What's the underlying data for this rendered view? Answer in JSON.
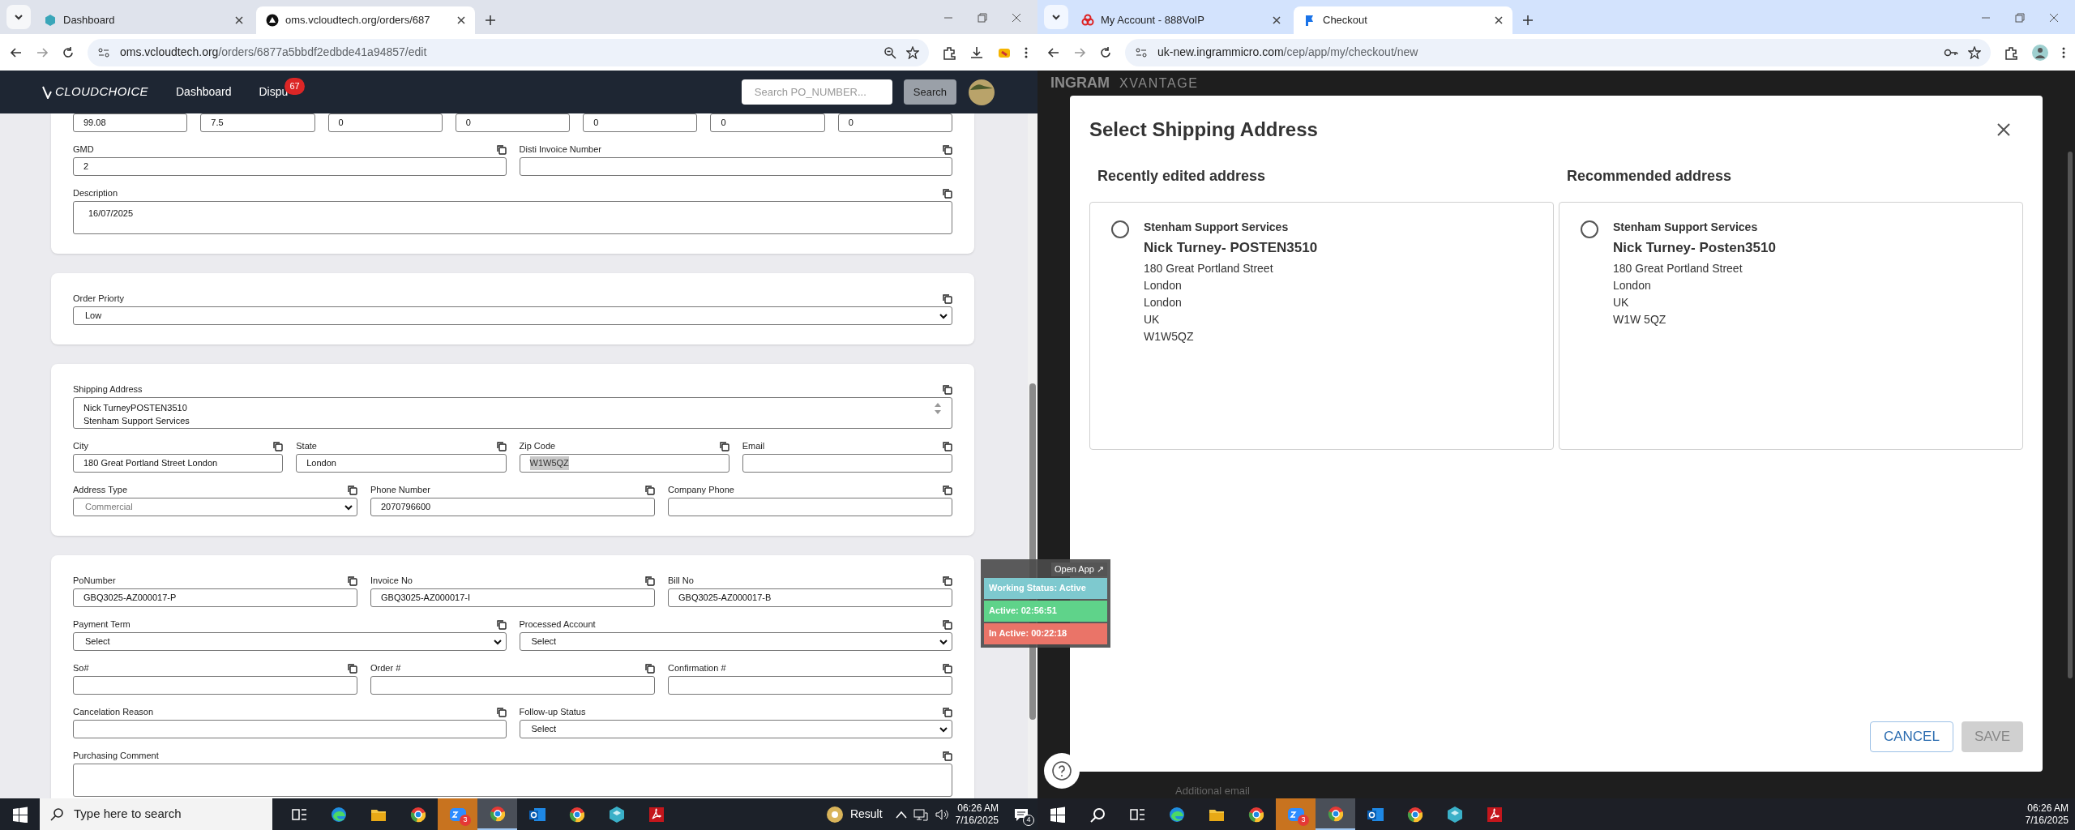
{
  "left_window": {
    "tabs": [
      {
        "title": "Dashboard",
        "selected": false
      },
      {
        "title": "oms.vcloudtech.org/orders/687",
        "selected": true
      }
    ],
    "url": {
      "host": "oms.vcloudtech.org",
      "path": "/orders/6877a5bbdf2edbde41a94857/edit"
    },
    "app_header": {
      "logo": "CLOUDCHOICE",
      "nav": [
        {
          "label": "Dashboard"
        },
        {
          "label": "Dispu",
          "badge": "67"
        }
      ],
      "search": {
        "placeholder": "Search PO_NUMBER..."
      },
      "search_button": "Search"
    },
    "cards": [
      {
        "rows": [
          {
            "fields": [
              {
                "kind": "input",
                "value": "99.08"
              },
              {
                "kind": "input",
                "value": "7.5"
              },
              {
                "kind": "input",
                "value": "0"
              },
              {
                "kind": "input",
                "value": "0"
              },
              {
                "kind": "input",
                "value": "0"
              },
              {
                "kind": "input",
                "value": "0"
              },
              {
                "kind": "input",
                "value": "0"
              }
            ]
          },
          {
            "fields": [
              {
                "kind": "input",
                "label": "GMD",
                "value": "2"
              },
              {
                "kind": "input",
                "label": "Disti Invoice Number"
              }
            ]
          },
          {
            "fields": [
              {
                "kind": "textarea",
                "label": "Description",
                "lines": [
                  "16/07/2025"
                ]
              }
            ]
          }
        ]
      },
      {
        "rows": [
          {
            "fields": [
              {
                "kind": "select",
                "label": "Order Priorty",
                "value": "Low",
                "disabled": false
              }
            ]
          }
        ]
      },
      {
        "rows": [
          {
            "fields": [
              {
                "kind": "textarea",
                "label": "Shipping Address",
                "lines": [
                  "Nick TurneyPOSTEN3510",
                  "Stenham Support Services"
                ]
              }
            ]
          },
          {
            "fields": [
              {
                "kind": "input",
                "label": "City",
                "value": "180 Great Portland Street London"
              },
              {
                "kind": "input",
                "label": "State",
                "value": "London"
              },
              {
                "kind": "input",
                "label": "Zip Code",
                "value": "W1W5QZ",
                "highlighted": true
              },
              {
                "kind": "input",
                "label": "Email"
              }
            ]
          },
          {
            "fields": [
              {
                "kind": "select",
                "label": "Address Type",
                "value": "Commercial",
                "disabled": true
              },
              {
                "kind": "input",
                "label": "Phone Number",
                "value": "2070796600"
              },
              {
                "kind": "input",
                "label": "Company Phone"
              }
            ]
          }
        ]
      },
      {
        "rows": [
          {
            "fields": [
              {
                "kind": "input",
                "label": "PoNumber",
                "value": "GBQ3025-AZ000017-P"
              },
              {
                "kind": "input",
                "label": "Invoice No",
                "value": "GBQ3025-AZ000017-I"
              },
              {
                "kind": "input",
                "label": "Bill No",
                "value": "GBQ3025-AZ000017-B"
              }
            ]
          },
          {
            "fields": [
              {
                "kind": "select",
                "label": "Payment Term",
                "value": "Select",
                "disabled": false
              },
              {
                "kind": "select",
                "label": "Processed Account",
                "value": "Select",
                "disabled": false
              }
            ]
          },
          {
            "fields": [
              {
                "kind": "input",
                "label": "So#"
              },
              {
                "kind": "input",
                "label": "Order #"
              },
              {
                "kind": "input",
                "label": "Confirmation #"
              }
            ]
          },
          {
            "fields": [
              {
                "kind": "input",
                "label": "Cancelation Reason"
              },
              {
                "kind": "select",
                "label": "Follow-up Status",
                "value": "Select",
                "disabled": false
              }
            ]
          },
          {
            "fields": [
              {
                "kind": "textarea",
                "label": "Purchasing Comment"
              }
            ]
          }
        ]
      }
    ]
  },
  "status_widget": {
    "open_app": "Open App ↗",
    "statuses": [
      {
        "text": "Working Status: Active",
        "color": "#7ec9cf"
      },
      {
        "text": "Active: 02:56:51",
        "color": "#5fd38a"
      },
      {
        "text": "In Active: 00:22:18",
        "color": "#ea7468"
      }
    ]
  },
  "right_window": {
    "tabs": [
      {
        "title": "My Account - 888VoIP",
        "selected": false
      },
      {
        "title": "Checkout",
        "selected": true
      }
    ],
    "url": {
      "host": "uk-new.ingrammicro.com",
      "path": "/cep/app/my/checkout/new"
    },
    "page_logo": [
      "INGRAM",
      "XVANTAGE"
    ],
    "background_label": "Additional email",
    "modal": {
      "title": "Select Shipping Address",
      "columns": [
        {
          "heading": "Recently edited address",
          "selected": false,
          "company": "Stenham Support Services",
          "name": "Nick Turney- POSTEN3510",
          "lines": [
            "180 Great Portland Street",
            "London",
            "London",
            "UK",
            "W1W5QZ"
          ]
        },
        {
          "heading": "Recommended address",
          "selected": false,
          "company": "Stenham Support Services",
          "name": "Nick Turney- Posten3510",
          "lines": [
            "180 Great Portland Street",
            "London",
            "UK",
            "W1W 5QZ"
          ]
        }
      ],
      "cancel": "CANCEL",
      "save": {
        "label": "SAVE",
        "disabled": true
      }
    }
  },
  "left_taskbar": {
    "search_placeholder": "Type here to search",
    "apps": [
      {
        "kind": "taskview",
        "active": false,
        "flashing": false
      },
      {
        "kind": "edge",
        "active": false,
        "flashing": false
      },
      {
        "kind": "folder",
        "active": false,
        "flashing": false
      },
      {
        "kind": "chrome",
        "active": false,
        "flashing": false
      },
      {
        "kind": "zoom",
        "badge": "3",
        "active": false,
        "flashing": true
      },
      {
        "kind": "chrome",
        "active": true,
        "flashing": false
      },
      {
        "kind": "outlook",
        "active": false,
        "flashing": false
      },
      {
        "kind": "chrome",
        "active": false,
        "flashing": false
      },
      {
        "kind": "cube",
        "active": false,
        "flashing": false
      },
      {
        "kind": "pdf",
        "active": false,
        "flashing": false
      }
    ],
    "weather": "Result",
    "time": "06:26 AM",
    "date": "7/16/2025",
    "notifications": "4"
  },
  "right_taskbar": {
    "apps": [
      {
        "kind": "search",
        "active": false,
        "flashing": false
      },
      {
        "kind": "taskview",
        "active": false,
        "flashing": false
      },
      {
        "kind": "edge",
        "active": false,
        "flashing": false
      },
      {
        "kind": "folder",
        "active": false,
        "flashing": false
      },
      {
        "kind": "chrome",
        "active": false,
        "flashing": false
      },
      {
        "kind": "zoom",
        "badge": "3",
        "active": false,
        "flashing": true
      },
      {
        "kind": "chrome",
        "active": true,
        "flashing": false
      },
      {
        "kind": "outlook",
        "active": false,
        "flashing": false
      },
      {
        "kind": "chrome",
        "active": false,
        "flashing": false
      },
      {
        "kind": "cube",
        "active": false,
        "flashing": false
      },
      {
        "kind": "pdf",
        "active": false,
        "flashing": false
      }
    ],
    "time": "06:26 AM",
    "date": "7/16/2025"
  }
}
